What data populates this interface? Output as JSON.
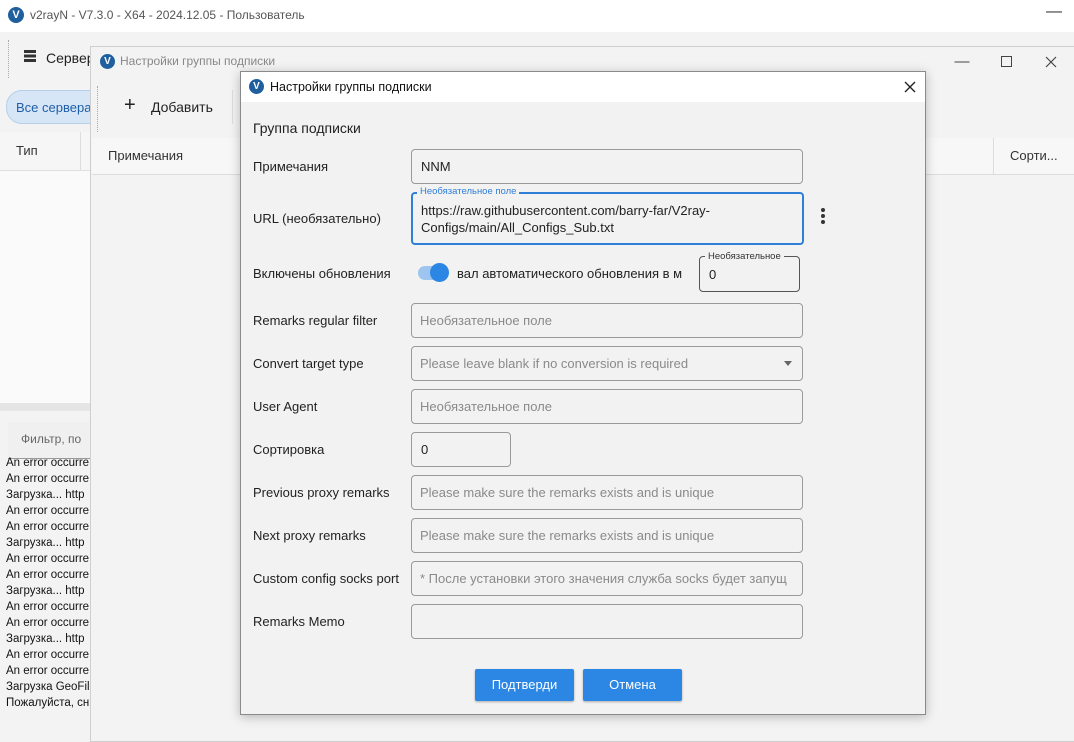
{
  "main_window": {
    "title": "v2rayN - V7.3.0 - X64 - 2024.12.05 - Пользователь",
    "logo_letter": "V",
    "minimize_glyph": "—",
    "toolbar": {
      "servers_label": "Сервер"
    },
    "all_servers_chip": "Все сервера",
    "grid": {
      "col_type": "Тип"
    },
    "filter_placeholder": "Фильтр, по",
    "log_lines": [
      "An error occurre",
      "An error occurre",
      "Загрузка...   http",
      "An error occurre",
      "An error occurre",
      "Загрузка...   http",
      "An error occurre",
      "An error occurre",
      "Загрузка...   http",
      "An error occurre",
      "An error occurre",
      "Загрузка...   http",
      "An error occurre",
      "An error occurre",
      "Загрузка GeoFile",
      "Пожалуйста, сн"
    ]
  },
  "group_window": {
    "title": "Настройки группы подписки",
    "add_label": "Добавить",
    "grid": {
      "col_notes": "Примечания",
      "col_sort": "Сорти..."
    }
  },
  "dialog": {
    "title": "Настройки группы подписки",
    "section_title": "Группа подписки",
    "remarks": {
      "label": "Примечания",
      "value": "NNM"
    },
    "url": {
      "label": "URL (необязательно)",
      "legend": "Необязательное поле",
      "value": "https://raw.githubusercontent.com/barry-far/V2ray-Configs/main/All_Configs_Sub.txt"
    },
    "auto_update": {
      "label": "Включены обновления",
      "enabled": true,
      "interval_label": "вал автоматического обновления в м",
      "interval_legend": "Необязательное",
      "interval_value": "0"
    },
    "filter": {
      "label": "Remarks regular filter",
      "placeholder": "Необязательное поле"
    },
    "convert_target": {
      "label": "Convert target type",
      "placeholder": "Please leave blank if no conversion is required"
    },
    "user_agent": {
      "label": "User Agent",
      "placeholder": "Необязательное поле"
    },
    "sort": {
      "label": "Сортировка",
      "value": "0"
    },
    "prev_proxy": {
      "label": "Previous proxy remarks",
      "placeholder": "Please make sure the remarks exists and is unique"
    },
    "next_proxy": {
      "label": "Next proxy remarks",
      "placeholder": "Please make sure the remarks exists and is unique"
    },
    "socks_port": {
      "label": "Custom config socks port",
      "placeholder": "* После установки этого значения служба socks будет запущ"
    },
    "memo": {
      "label": "Remarks Memo",
      "value": ""
    },
    "confirm_label": "Подтверди",
    "cancel_label": "Отмена",
    "accent_color": "#2b86e4"
  }
}
